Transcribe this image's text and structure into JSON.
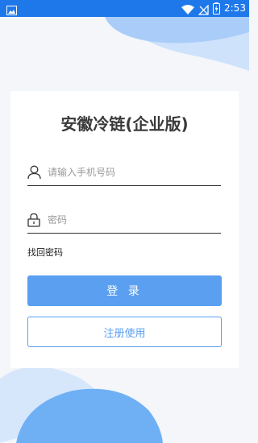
{
  "status_bar": {
    "time": "2:53",
    "left_icon": "image-icon",
    "right_icons": [
      "wifi-icon",
      "no-signal-icon",
      "battery-charging-icon"
    ]
  },
  "app": {
    "title": "安徽冷链(企业版)"
  },
  "form": {
    "phone_placeholder": "请输入手机号码",
    "phone_value": "",
    "password_placeholder": "密码",
    "password_value": "",
    "forgot_label": "找回密码",
    "login_label": "登 录",
    "register_label": "注册使用"
  },
  "colors": {
    "status_bar": "#1f78ea",
    "accent": "#5a9ff0",
    "decor_light": "#cfe2fb",
    "decor_mid": "#a9cdf8",
    "decor_dark": "#6fb0f5"
  }
}
